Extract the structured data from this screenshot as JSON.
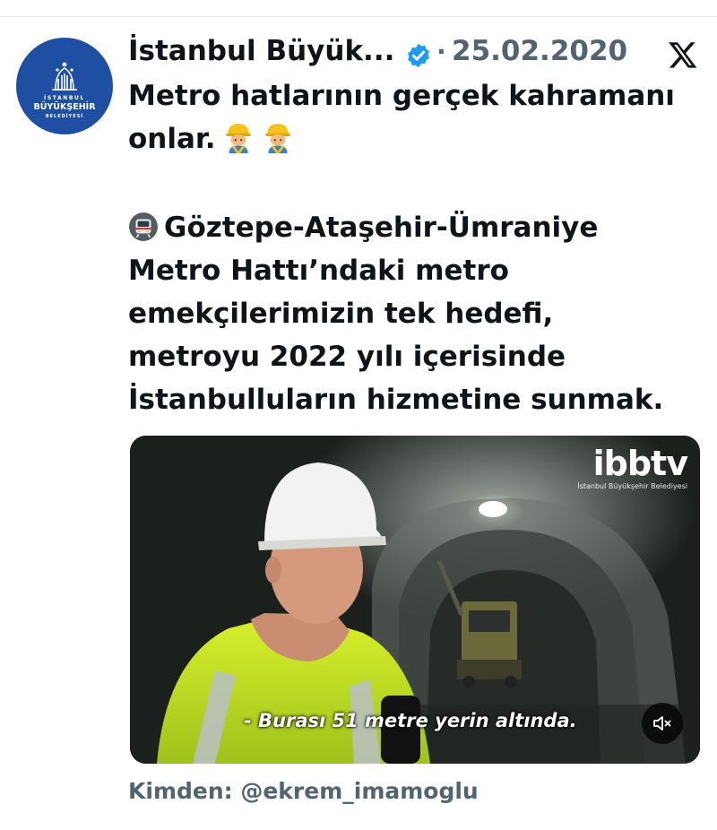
{
  "account": {
    "name": "İstanbul Büyük...",
    "date": "25.02.2020",
    "separator": "·",
    "verified_color": "#1d9bf0",
    "avatar": {
      "line1": "İSTANBUL",
      "line2": "BÜYÜKŞEHİR",
      "line3": "BELEDİYESİ",
      "background": "#1e4fa3"
    }
  },
  "tweet": {
    "line1": "Metro hatlarının gerçek kahramanı",
    "line2": "onlar.",
    "line2_emojis": [
      "construction-worker-emoji",
      "construction-worker-emoji"
    ],
    "line3_emoji": "metro-emoji",
    "line3": "Göztepe-Ataşehir-Ümraniye",
    "line4": "Metro Hattı’ndaki metro",
    "line5": "emekçilerimizin tek hedefi,",
    "line6": "metroyu 2022 yılı içerisinde",
    "line7": "İstanbulluların hizmetine sunmak."
  },
  "video": {
    "brand_logo": "ibbtv",
    "brand_sub": "İstanbul Büyükşehir Belediyesi",
    "subtitle": "- Burası 51 metre yerin altında.",
    "mute_icon": "speaker-muted-icon"
  },
  "source": {
    "text": "Kimden: @ekrem_imamoglu"
  },
  "colors": {
    "text": "#0f1419",
    "muted": "#536471",
    "divider": "#e6e9ec"
  }
}
